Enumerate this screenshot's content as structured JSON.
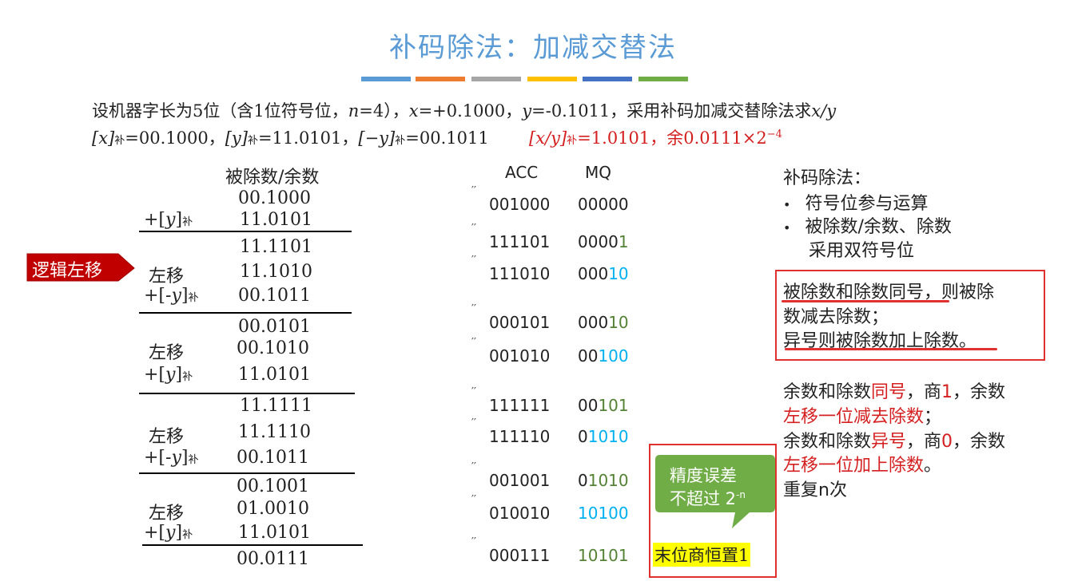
{
  "title": "补码除法：加减交替法",
  "color_bars": [
    "#5b9bd5",
    "#ed7d31",
    "#a5a5a5",
    "#ffc000",
    "#4472c4",
    "#70ad47"
  ],
  "line1": {
    "prefix": "设机器字长为5位（含1位符号位，",
    "n": "n",
    "n_val": "=4），",
    "x": "x",
    "x_val": "=+0.1000，",
    "y": "y",
    "y_val": "=-0.1011，采用补码加减交替除法求",
    "xy": "x/y"
  },
  "line2": {
    "x_comp": "[x]",
    "x_comp_val": "=00.1000，",
    "y_comp": "[y]",
    "y_comp_val": "=11.0101，",
    "ny_comp": "[−y]",
    "ny_comp_val": "=00.1011",
    "bu": "补",
    "result_label": "[x/y]",
    "result_val": "=1.0101，余0.0111×2",
    "result_exp": "−4"
  },
  "left": {
    "header": "被除数/余数",
    "tag": "逻辑左移",
    "rows": [
      {
        "label": "",
        "value": "00.1000"
      },
      {
        "label": "+[y]补",
        "value": "11.0101"
      },
      {
        "label": "",
        "value": "11.1101"
      },
      {
        "label": "左移",
        "value": "11.1010"
      },
      {
        "label": "+[-y]补",
        "value": "00.1011"
      },
      {
        "label": "",
        "value": "00.0101"
      },
      {
        "label": "左移",
        "value": "00.1010"
      },
      {
        "label": "+[y]补",
        "value": "11.0101"
      },
      {
        "label": "",
        "value": "11.1111"
      },
      {
        "label": "左移",
        "value": "11.1110"
      },
      {
        "label": "+[-y]补",
        "value": "00.1011"
      },
      {
        "label": "",
        "value": "00.1001"
      },
      {
        "label": "左移",
        "value": "01.0010"
      },
      {
        "label": "+[y]补",
        "value": "11.0101"
      },
      {
        "label": "",
        "value": "00.0111"
      }
    ]
  },
  "registers": {
    "acc_header": "ACC",
    "mq_header": "MQ",
    "rows": [
      {
        "acc": "001000",
        "mq_black": "00000",
        "mq_green": "",
        "mq_blue": ""
      },
      {
        "acc": "111101",
        "mq_black": "0000",
        "mq_green": "1",
        "mq_blue": ""
      },
      {
        "acc": "111010",
        "mq_black": "000",
        "mq_green": "",
        "mq_blue": "10"
      },
      {
        "acc": "000101",
        "mq_black": "000",
        "mq_green": "10",
        "mq_blue": ""
      },
      {
        "acc": "001010",
        "mq_black": "00",
        "mq_green": "",
        "mq_blue": "100"
      },
      {
        "acc": "111111",
        "mq_black": "00",
        "mq_green": "101",
        "mq_blue": ""
      },
      {
        "acc": "111110",
        "mq_black": "0",
        "mq_green": "",
        "mq_blue": "1010"
      },
      {
        "acc": "001001",
        "mq_black": "0",
        "mq_green": "1010",
        "mq_blue": ""
      },
      {
        "acc": "010010",
        "mq_black": "",
        "mq_green": "",
        "mq_blue": "10100"
      },
      {
        "acc": "000111",
        "mq_black": "",
        "mq_green": "10101",
        "mq_blue": ""
      }
    ]
  },
  "callout": {
    "line1": "精度误差",
    "line2": "不超过 2",
    "exp": "-n",
    "last_bit": "末位商恒置1"
  },
  "rules": {
    "title": "补码除法：",
    "bullets": [
      "符号位参与运算",
      "被除数/余数、除数",
      "采用双符号位"
    ],
    "box_line1_a": "被除数和除数同号",
    "box_line1_b": "，则被除",
    "box_line2": "数减去除数；",
    "box_line3": "异号则被除数加上除数。",
    "p1_a": "余数和除数",
    "p1_red1": "同号",
    "p1_b": "，商",
    "p1_red2": "1",
    "p1_c": "，余数",
    "p1_line2": "左移一位减去除数",
    "p1_semi": "；",
    "p2_a": "余数和除数",
    "p2_red1": "异号",
    "p2_b": "，商",
    "p2_red2": "0",
    "p2_c": "，余数",
    "p2_line2": "左移一位加上除数",
    "p2_end": "。",
    "repeat": "重复n次"
  }
}
